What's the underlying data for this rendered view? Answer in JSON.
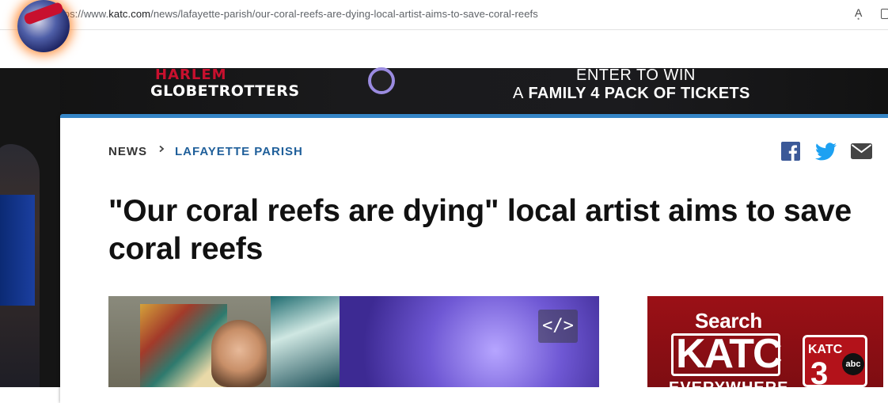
{
  "browser": {
    "url_prefix": "https://www.",
    "url_domain": "katc.com",
    "url_path": "/news/lafayette-parish/our-coral-reefs-are-dying-local-artist-aims-to-save-coral-reefs",
    "read_aloud_icon": "A͙"
  },
  "ad_banner": {
    "brand_top": "HARLEM",
    "brand_name": "GLOBETROTTERS",
    "line1": "ENTER TO WIN",
    "line2_prefix": "A",
    "line2_bold": "FAMILY 4 PACK OF TICKETS"
  },
  "breadcrumb": {
    "section": "NEWS",
    "subsection": "LAFAYETTE PARISH"
  },
  "share": {
    "facebook_icon": "facebook-icon",
    "twitter_icon": "twitter-icon",
    "email_icon": "email-icon"
  },
  "article": {
    "headline": "\"Our coral reefs are dying\" local artist aims to save coral reefs",
    "embed_label": "</>"
  },
  "side_ad": {
    "search": "Search",
    "brand": "KATC",
    "tagline": "EVERYWHERE",
    "logo_text": "KATC",
    "logo_network": "abc",
    "logo_number": "3"
  },
  "colors": {
    "accent_blue": "#3585c6",
    "breadcrumb_blue": "#1f5f9a",
    "facebook": "#3b5998",
    "twitter": "#1da1f2",
    "ad_red": "#9b1016"
  }
}
